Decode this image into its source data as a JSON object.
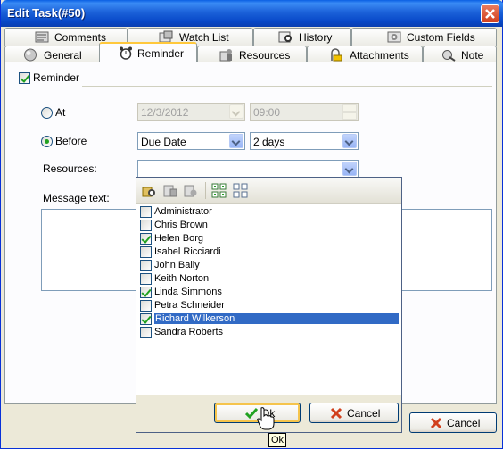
{
  "window": {
    "title": "Edit Task(#50)"
  },
  "tabs_row1": [
    {
      "label": "Comments",
      "icon": "comments-icon"
    },
    {
      "label": "Watch List",
      "icon": "watch-list-icon"
    },
    {
      "label": "History",
      "icon": "history-icon"
    },
    {
      "label": "Custom Fields",
      "icon": "custom-fields-icon"
    }
  ],
  "tabs_row2": [
    {
      "label": "General",
      "icon": "general-icon"
    },
    {
      "label": "Reminder",
      "icon": "alarm-clock-icon",
      "active": true
    },
    {
      "label": "Resources",
      "icon": "resources-icon"
    },
    {
      "label": "Attachments",
      "icon": "attachments-icon"
    },
    {
      "label": "Note",
      "icon": "note-icon"
    }
  ],
  "reminder": {
    "enabled_label": "Reminder",
    "enabled": true,
    "at_label": "At",
    "at_date": "12/3/2012",
    "at_time": "09:00",
    "before_label": "Before",
    "before_selected": true,
    "before_ref": "Due Date",
    "before_amount": "2 days",
    "resources_label": "Resources:",
    "resources_value": "",
    "message_label": "Message text:"
  },
  "resources_popup": {
    "items": [
      {
        "name": "Administrator",
        "checked": false
      },
      {
        "name": "Chris Brown",
        "checked": false
      },
      {
        "name": "Helen Borg",
        "checked": true
      },
      {
        "name": "Isabel Ricciardi",
        "checked": false
      },
      {
        "name": "John Baily",
        "checked": false
      },
      {
        "name": "Keith Norton",
        "checked": false
      },
      {
        "name": "Linda Simmons",
        "checked": true
      },
      {
        "name": "Petra Schneider",
        "checked": false
      },
      {
        "name": "Richard Wilkerson",
        "checked": true,
        "selected": true
      },
      {
        "name": "Sandra Roberts",
        "checked": false
      }
    ],
    "ok_label": "Ok",
    "cancel_label": "Cancel"
  },
  "dialog_cancel_label": "Cancel",
  "tooltip_text": "Ok",
  "colors": {
    "title_blue": "#0A5FE3",
    "selection": "#316AC5",
    "check_green": "#21A121",
    "cancel_red": "#D1401D"
  }
}
